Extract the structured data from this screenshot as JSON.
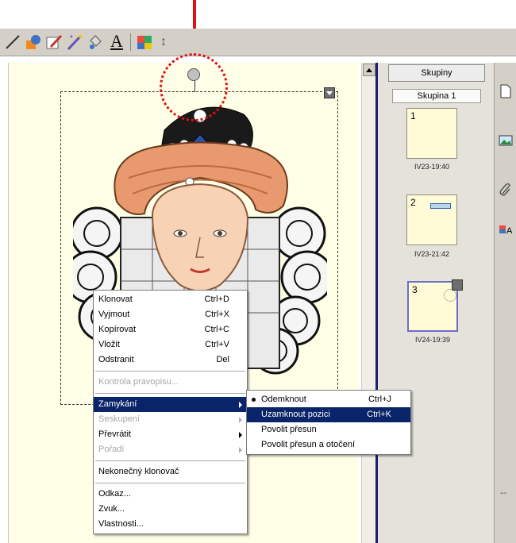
{
  "panel": {
    "button_label": "Skupiny",
    "group_label": "Skupina 1",
    "pages": [
      {
        "number": "1",
        "caption": "IV23-19:40"
      },
      {
        "number": "2",
        "caption": "IV23-21:42"
      },
      {
        "number": "3",
        "caption": "IV24-19:39"
      }
    ]
  },
  "context_menu": {
    "items": [
      {
        "label": "Klonovat",
        "shortcut": "Ctrl+D"
      },
      {
        "label": "Vyjmout",
        "shortcut": "Ctrl+X"
      },
      {
        "label": "Kopírovat",
        "shortcut": "Ctrl+C"
      },
      {
        "label": "Vložit",
        "shortcut": "Ctrl+V"
      },
      {
        "label": "Odstranit",
        "shortcut": "Del"
      },
      {
        "label": "Kontrola pravopisu..."
      },
      {
        "label": "Zamykání"
      },
      {
        "label": "Seskupení"
      },
      {
        "label": "Převrátit"
      },
      {
        "label": "Pořadí"
      },
      {
        "label": "Nekonečný klonovač"
      },
      {
        "label": "Odkaz..."
      },
      {
        "label": "Zvuk..."
      },
      {
        "label": "Vlastnosti..."
      }
    ]
  },
  "submenu": {
    "items": [
      {
        "label": "Odemknout",
        "shortcut": "Ctrl+J"
      },
      {
        "label": "Uzamknout pozici",
        "shortcut": "Ctrl+K"
      },
      {
        "label": "Povolit přesun"
      },
      {
        "label": "Povolit přesun a otočení"
      }
    ]
  },
  "toolbar_font_icon": "A",
  "colors": {
    "highlight": "#0a246a",
    "callout": "#e01010",
    "canvas": "#fffee6",
    "thumb": "#fffbd7"
  }
}
